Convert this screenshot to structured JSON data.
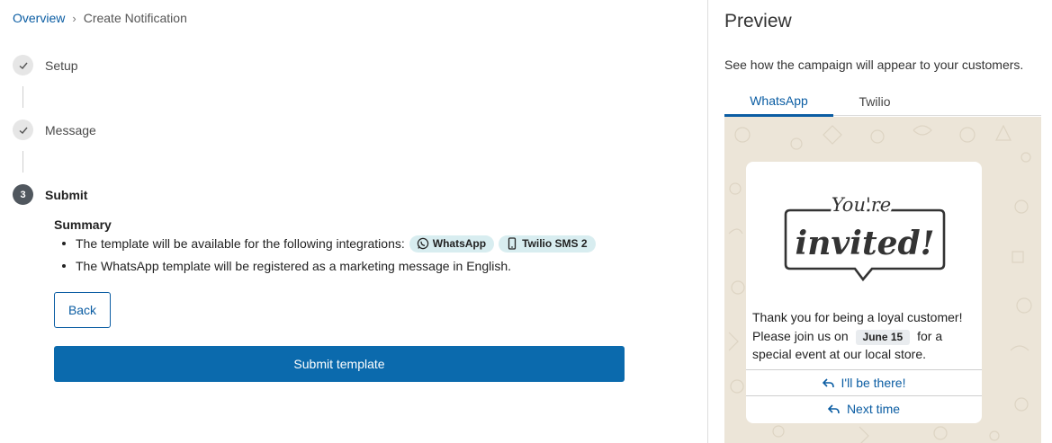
{
  "breadcrumb": {
    "root": "Overview",
    "separator": "›",
    "current": "Create Notification"
  },
  "steps": [
    {
      "label": "Setup",
      "state": "done"
    },
    {
      "label": "Message",
      "state": "done"
    },
    {
      "label": "Submit",
      "number": "3",
      "state": "active"
    }
  ],
  "summary": {
    "title": "Summary",
    "line1": "The template will be available for the following integrations:",
    "chip_whatsapp": "WhatsApp",
    "chip_twilio": "Twilio SMS 2",
    "line2": "The WhatsApp template will be registered as a marketing message in English."
  },
  "actions": {
    "back": "Back",
    "submit": "Submit template"
  },
  "preview": {
    "title": "Preview",
    "description": "See how the campaign will appear to your customers.",
    "tabs": [
      "WhatsApp",
      "Twilio"
    ],
    "image_text_line1": "You're",
    "image_text_line2": "invited!",
    "message_part1": "Thank you for being a loyal customer! Please join us on",
    "date": "June 15",
    "message_part2": "for a special event at our local store.",
    "quick_replies": [
      "I'll be there!",
      "Next time"
    ]
  },
  "colors": {
    "accent": "#0b5da3",
    "primary_button": "#0b6aad",
    "chip_bg": "#d8edf0",
    "chat_bg": "#ece5d8"
  }
}
